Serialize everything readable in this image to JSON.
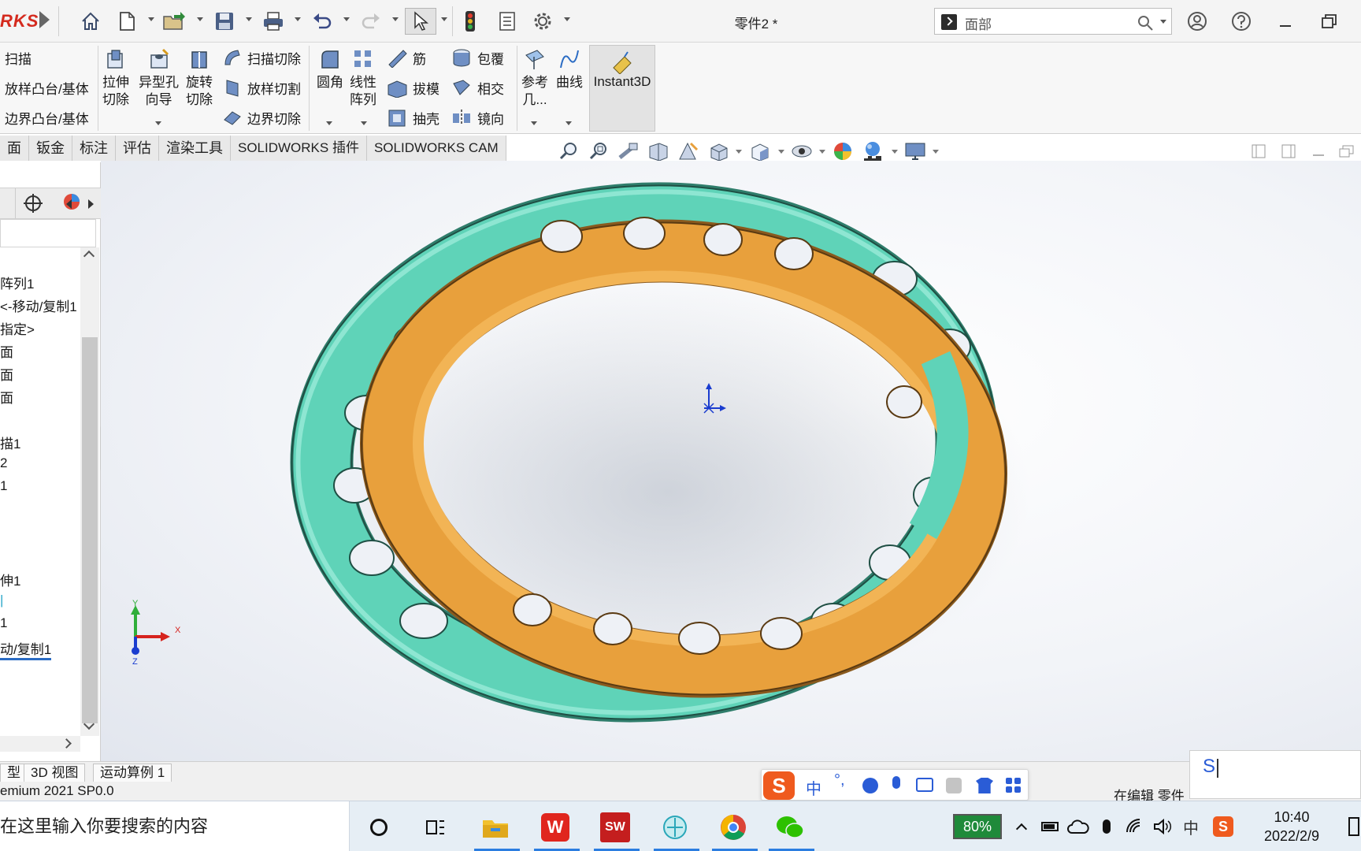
{
  "app": {
    "brand": "RKS",
    "doc_title": "零件2 *"
  },
  "search": {
    "value": "面部"
  },
  "ribbon": {
    "features": {
      "sweep": "扫描",
      "loft_boss": "放样凸台/基体",
      "boundary_boss": "边界凸台/基体",
      "extrude_cut": [
        "拉伸",
        "切除"
      ],
      "hole_wizard": [
        "异型孔",
        "向导"
      ],
      "revolve_cut": [
        "旋转",
        "切除"
      ],
      "swept_cut": "扫描切除",
      "lofted_cut": "放样切割",
      "boundary_cut": "边界切除",
      "fillet": "圆角",
      "linear_pattern": [
        "线性",
        "阵列"
      ],
      "rib": "筋",
      "draft": "拔模",
      "shell": "抽壳",
      "wrap": "包覆",
      "intersect": "相交",
      "mirror": "镜向",
      "ref_geometry": [
        "参考",
        "几..."
      ],
      "curves": "曲线",
      "instant3d": "Instant3D"
    }
  },
  "tabs": [
    "面",
    "钣金",
    "标注",
    "评估",
    "渲染工具",
    "SOLIDWORKS 插件",
    "SOLIDWORKS CAM"
  ],
  "tree": {
    "items": [
      "阵列1",
      "<-移动/复制1",
      "指定>",
      "面",
      "面",
      "面",
      "描1",
      "2",
      "1",
      "伸1",
      "1",
      "动/复制1"
    ]
  },
  "triad": {
    "x": "X",
    "y": "Y",
    "z": "Z"
  },
  "bottom_tabs": [
    "型",
    "3D 视图",
    "运动算例 1"
  ],
  "status": {
    "left": "emium 2021 SP0.0",
    "right": "在编辑 零件"
  },
  "ime": {
    "mode": "中",
    "composition": "S"
  },
  "taskbar": {
    "search_placeholder": "在这里输入你要搜索的内容",
    "battery": "80%",
    "tray_ime": "中",
    "time": "10:40",
    "date": "2022/2/9"
  },
  "colors": {
    "teal": "#5fd3b8",
    "orange": "#e8a03c",
    "brand_red": "#d42a1e",
    "origin_blue": "#1a3ccf"
  }
}
